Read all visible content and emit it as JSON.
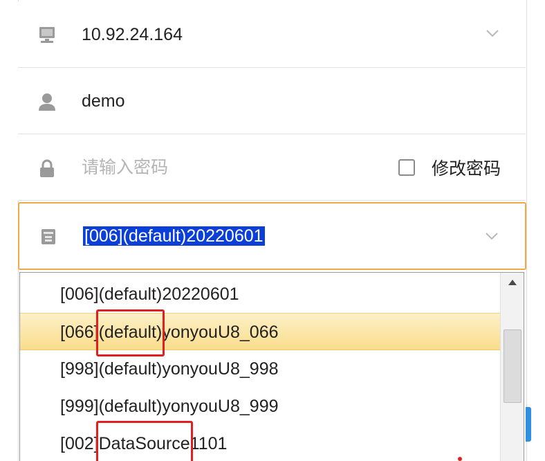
{
  "server": {
    "value": "10.92.24.164",
    "icon": "computer-icon"
  },
  "user": {
    "value": "demo",
    "icon": "user-icon"
  },
  "password": {
    "placeholder": "请输入密码",
    "change_label": "修改密码",
    "change_checked": false,
    "icon": "lock-icon"
  },
  "database": {
    "value": "[006](default)20220601",
    "icon": "database-icon"
  },
  "dropdown": {
    "options": [
      {
        "label": "[006](default)20220601"
      },
      {
        "prefix": "[066]",
        "highlight": "(default)",
        "suffix": "yonyouU8_066"
      },
      {
        "label": "[998](default)yonyouU8_998"
      },
      {
        "label": "[999](default)yonyouU8_999"
      },
      {
        "prefix": "[002]",
        "highlight": "DataSource",
        "suffix": "1101"
      }
    ],
    "hovered_index": 1
  },
  "colors": {
    "focus_border": "#f0a94a",
    "selection": "#0b3fd8",
    "highlight_box": "#e0201e",
    "hover_bg": "#f9dd8c"
  }
}
